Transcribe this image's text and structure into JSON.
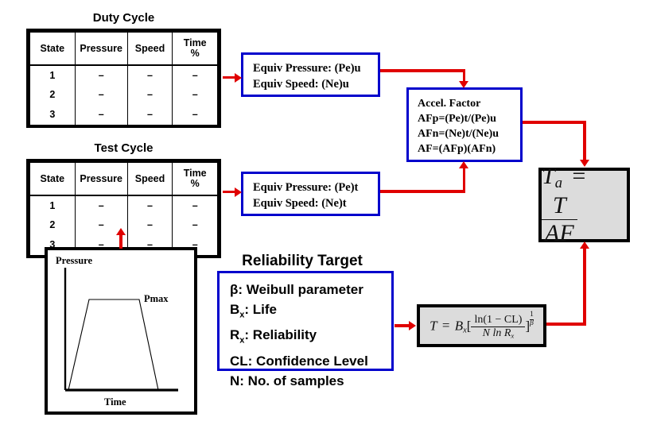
{
  "duty_cycle": {
    "title": "Duty Cycle",
    "columns": [
      "State",
      "Pressure",
      "Speed",
      "Time\n%"
    ],
    "col_time_line1": "Time",
    "col_time_line2": "%",
    "rows": [
      {
        "state": "1",
        "pressure": "–",
        "speed": "–",
        "time": "–"
      },
      {
        "state": "2",
        "pressure": "–",
        "speed": "–",
        "time": "–"
      },
      {
        "state": "3",
        "pressure": "–",
        "speed": "–",
        "time": "–"
      }
    ]
  },
  "test_cycle": {
    "title": "Test Cycle",
    "columns": [
      "State",
      "Pressure",
      "Speed",
      "Time\n%"
    ],
    "col_time_line1": "Time",
    "col_time_line2": "%",
    "rows": [
      {
        "state": "1",
        "pressure": "–",
        "speed": "–",
        "time": "–"
      },
      {
        "state": "2",
        "pressure": "–",
        "speed": "–",
        "time": "–"
      },
      {
        "state": "3",
        "pressure": "–",
        "speed": "–",
        "time": "–"
      }
    ]
  },
  "equiv_use": {
    "line1": "Equiv Pressure: (Pe)u",
    "line2": "Equiv Speed: (Ne)u"
  },
  "equiv_test": {
    "line1": "Equiv Pressure: (Pe)t",
    "line2": "Equiv Speed: (Ne)t"
  },
  "accel_factor": {
    "title": "Accel. Factor",
    "line1": "AFp=(Pe)t/(Pe)u",
    "line2": "AFn=(Ne)t/(Ne)u",
    "line3": "AF=(AFp)(AFn)"
  },
  "ta_formula": {
    "lhs": "T",
    "lhs_sub": "a",
    "equals": "=",
    "numerator": "T",
    "denominator": "AF"
  },
  "t_formula": {
    "lhs": "T",
    "equals": "=",
    "b": "B",
    "b_sub": "x",
    "bracket_open": "[",
    "numerator": "ln(1 − CL)",
    "denominator": "N ln R",
    "denominator_sub": "x",
    "bracket_close": "]",
    "exp_num": "1",
    "exp_den": "β"
  },
  "reliability_target": {
    "title": "Reliability Target",
    "items": [
      {
        "symbol": "β",
        "sub": "",
        "text": ": Weibull parameter"
      },
      {
        "symbol": "B",
        "sub": "x",
        "text": ": Life"
      },
      {
        "symbol": "R",
        "sub": "x",
        "text": ": Reliability"
      },
      {
        "symbol": "CL",
        "sub": "",
        "text": ": Confidence Level"
      },
      {
        "symbol": "N",
        "sub": "",
        "text": ": No. of samples"
      }
    ]
  },
  "pressure_chart": {
    "y_axis_label": "Pressure",
    "x_axis_label": "Time",
    "peak_label": "Pmax",
    "profile": "trapezoid"
  },
  "colors": {
    "connector": "#e00000",
    "box_border_blue": "#0000cc",
    "box_fill_gray": "#dcdcdc",
    "border_black": "#000000",
    "background": "#ffffff"
  }
}
